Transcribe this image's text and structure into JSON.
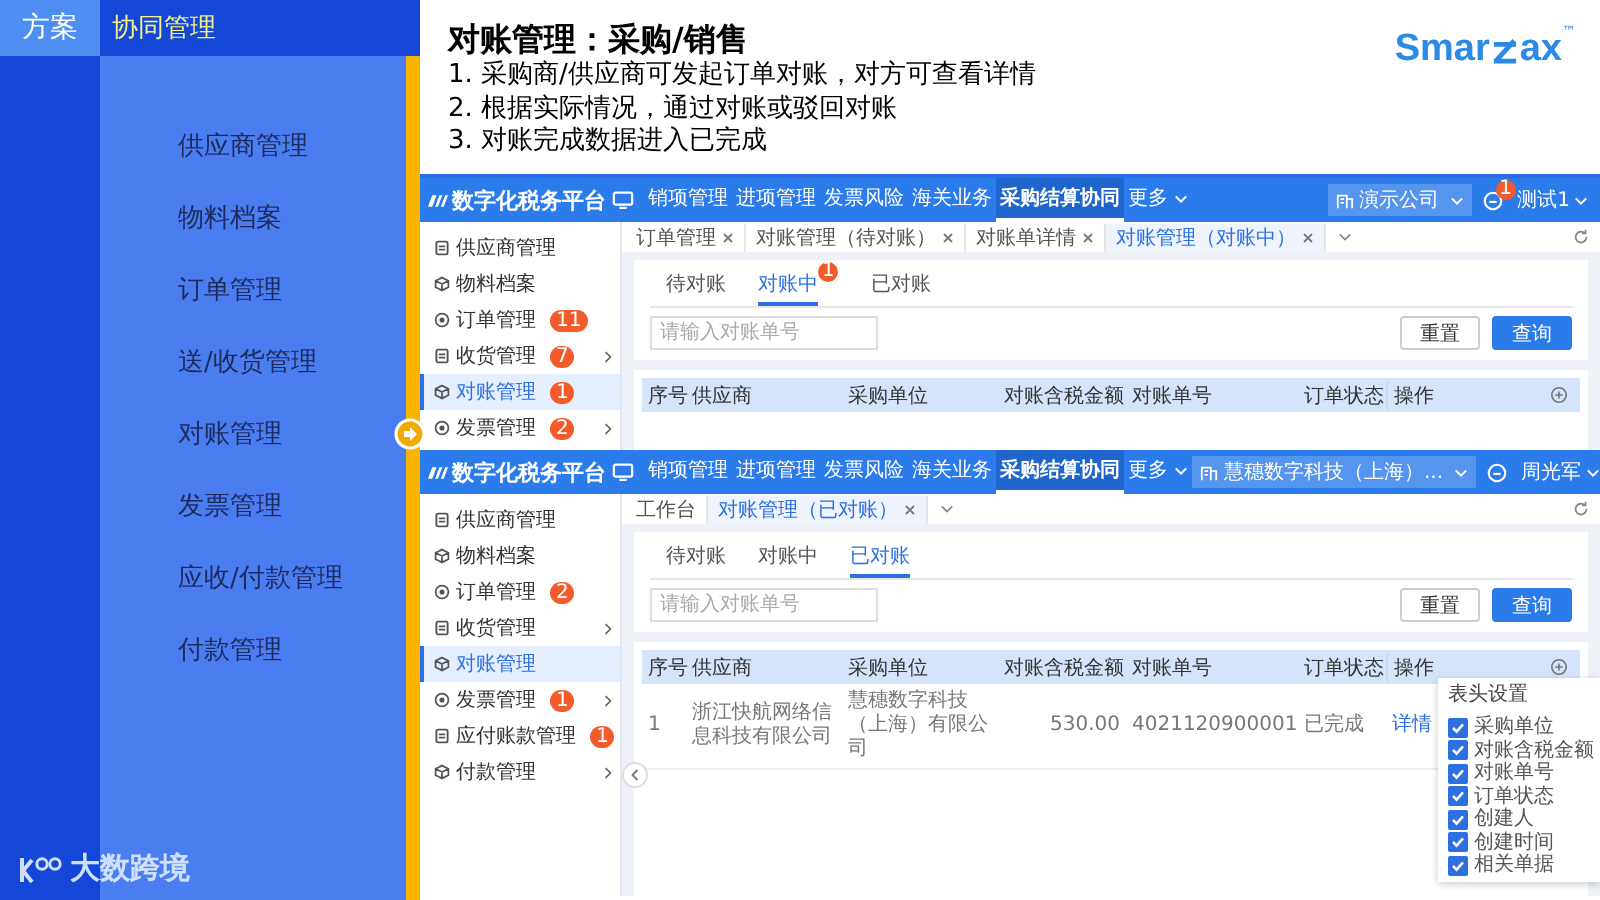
{
  "slide": {
    "tab": "方案",
    "section": "协同管理",
    "menu": [
      {
        "label": "供应商管理",
        "selected": false
      },
      {
        "label": "物料档案",
        "selected": false
      },
      {
        "label": "订单管理",
        "selected": false
      },
      {
        "label": "送/收货管理",
        "selected": false
      },
      {
        "label": "对账管理",
        "selected": true
      },
      {
        "label": "发票管理",
        "selected": false
      },
      {
        "label": "应收/付款管理",
        "selected": false
      },
      {
        "label": "付款管理",
        "selected": false
      }
    ],
    "brand": "大数跨境"
  },
  "heading": {
    "title": "对账管理：采购/销售",
    "points": [
      "1. 采购商/供应商可发起订单对账，对方可查看详情",
      "2. 根据实际情况，通过对账或驳回对账",
      "3. 对账完成数据进入已完成"
    ],
    "logo_start": "Smar",
    "logo_end": "ax",
    "logo_mark": "™"
  },
  "screens": [
    {
      "app_title": "数字化税务平台",
      "nav": [
        {
          "label": "销项管理",
          "selected": false,
          "dropdown": false
        },
        {
          "label": "进项管理",
          "selected": false,
          "dropdown": false
        },
        {
          "label": "发票风险",
          "selected": false,
          "dropdown": false
        },
        {
          "label": "海关业务",
          "selected": false,
          "dropdown": false
        },
        {
          "label": "采购结算协同",
          "selected": true,
          "dropdown": false
        },
        {
          "label": "更多",
          "selected": false,
          "dropdown": true
        }
      ],
      "company": "演示公司",
      "notice_badge": "1",
      "user": "测试1",
      "sidebar": [
        {
          "label": "供应商管理",
          "selected": false,
          "expandable": false
        },
        {
          "label": "物料档案",
          "selected": false,
          "expandable": false
        },
        {
          "label": "订单管理",
          "selected": false,
          "expandable": false,
          "badge": "11"
        },
        {
          "label": "收货管理",
          "selected": false,
          "expandable": true,
          "badge": "7"
        },
        {
          "label": "对账管理",
          "selected": true,
          "expandable": false,
          "badge": "1"
        },
        {
          "label": "发票管理",
          "selected": false,
          "expandable": true,
          "badge": "2"
        }
      ],
      "tabs": [
        {
          "label": "订单管理",
          "selected": false,
          "closable": true
        },
        {
          "label": "对账管理（待对账）",
          "selected": false,
          "closable": true
        },
        {
          "label": "对账单详情",
          "selected": false,
          "closable": true
        },
        {
          "label": "对账管理（对账中）",
          "selected": true,
          "closable": true
        }
      ],
      "subtabs": [
        {
          "label": "待对账",
          "selected": false
        },
        {
          "label": "对账中",
          "selected": true,
          "badge": "1"
        },
        {
          "label": "已对账",
          "selected": false
        }
      ],
      "search_placeholder": "请输入对账单号",
      "buttons": [
        "重置",
        "查询"
      ],
      "columns": [
        "序号",
        "供应商",
        "采购单位",
        "对账含税金额",
        "对账单号",
        "订单状态",
        "操作"
      ]
    },
    {
      "app_title": "数字化税务平台",
      "nav": [
        {
          "label": "销项管理",
          "selected": false,
          "dropdown": false
        },
        {
          "label": "进项管理",
          "selected": false,
          "dropdown": false
        },
        {
          "label": "发票风险",
          "selected": false,
          "dropdown": false
        },
        {
          "label": "海关业务",
          "selected": false,
          "dropdown": false
        },
        {
          "label": "采购结算协同",
          "selected": true,
          "dropdown": false
        },
        {
          "label": "更多",
          "selected": false,
          "dropdown": true
        }
      ],
      "company": "慧穗数字科技（上海）...",
      "user": "周光军",
      "sidebar": [
        {
          "label": "供应商管理",
          "selected": false,
          "expandable": false
        },
        {
          "label": "物料档案",
          "selected": false,
          "expandable": false
        },
        {
          "label": "订单管理",
          "selected": false,
          "expandable": false,
          "badge": "2"
        },
        {
          "label": "收货管理",
          "selected": false,
          "expandable": true
        },
        {
          "label": "对账管理",
          "selected": true,
          "expandable": false
        },
        {
          "label": "发票管理",
          "selected": false,
          "expandable": true,
          "badge": "1"
        },
        {
          "label": "应付账款管理",
          "selected": false,
          "expandable": false,
          "badge": "1"
        },
        {
          "label": "付款管理",
          "selected": false,
          "expandable": true
        }
      ],
      "sidebar_toggle": true,
      "tabs": [
        {
          "label": "工作台",
          "selected": false,
          "closable": false
        },
        {
          "label": "对账管理（已对账）",
          "selected": true,
          "closable": true
        }
      ],
      "subtabs": [
        {
          "label": "待对账",
          "selected": false
        },
        {
          "label": "对账中",
          "selected": false
        },
        {
          "label": "已对账",
          "selected": true
        }
      ],
      "search_placeholder": "请输入对账单号",
      "buttons": [
        "重置",
        "查询"
      ],
      "columns": [
        "序号",
        "供应商",
        "采购单位",
        "对账含税金额",
        "对账单号",
        "订单状态",
        "操作"
      ],
      "rows": [
        {
          "cells": [
            "1",
            "浙江快航网络信息科技有限公司",
            "慧穗数字科技（上海）有限公司",
            "530.00",
            "4021120900001",
            "已完成"
          ],
          "action": "详情"
        }
      ],
      "column_settings": {
        "title": "表头设置",
        "options": [
          {
            "label": "采购单位",
            "checked": true
          },
          {
            "label": "对账含税金额",
            "checked": true
          },
          {
            "label": "对账单号",
            "checked": true
          },
          {
            "label": "订单状态",
            "checked": true
          },
          {
            "label": "创建人",
            "checked": true
          },
          {
            "label": "创建时间",
            "checked": true
          },
          {
            "label": "相关单据",
            "checked": true
          }
        ]
      }
    }
  ]
}
